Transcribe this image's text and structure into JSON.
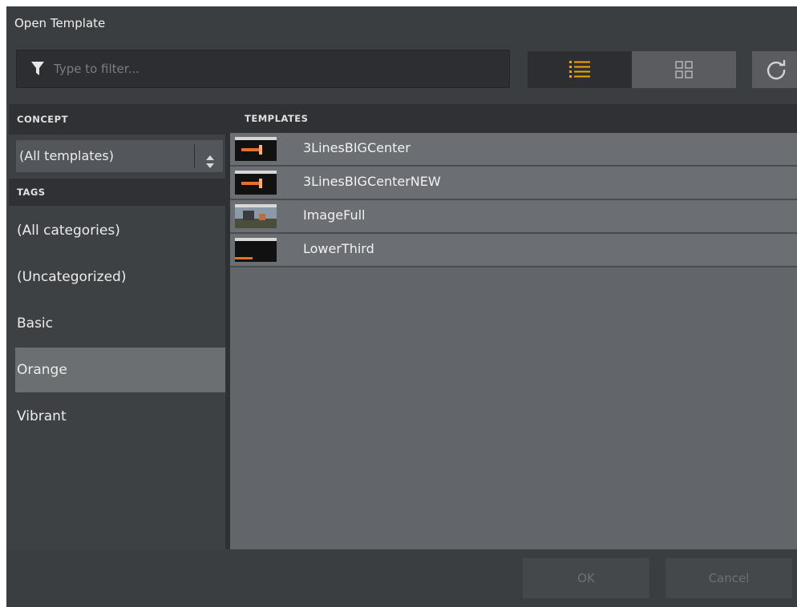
{
  "dialog": {
    "title": "Open Template"
  },
  "toolbar": {
    "filter_placeholder": "Type to filter...",
    "filter_value": "",
    "filter_icon": "filter-icon",
    "list_view_icon": "list-view-icon",
    "grid_view_icon": "grid-view-icon",
    "refresh_icon": "refresh-icon",
    "active_view": "list"
  },
  "concept": {
    "header": "CONCEPT",
    "selected": "(All templates)"
  },
  "tags": {
    "header": "TAGS",
    "items": [
      {
        "label": "(All categories)",
        "selected": false
      },
      {
        "label": "(Uncategorized)",
        "selected": false
      },
      {
        "label": "Basic",
        "selected": false
      },
      {
        "label": "Orange",
        "selected": true
      },
      {
        "label": "Vibrant",
        "selected": false
      }
    ]
  },
  "templates": {
    "header": "TEMPLATES",
    "items": [
      {
        "name": "3LinesBIGCenter",
        "thumb": "orange-bar"
      },
      {
        "name": "3LinesBIGCenterNEW",
        "thumb": "orange-bar"
      },
      {
        "name": "ImageFull",
        "thumb": "image"
      },
      {
        "name": "LowerThird",
        "thumb": "lower-third"
      }
    ]
  },
  "footer": {
    "ok_label": "OK",
    "cancel_label": "Cancel"
  },
  "colors": {
    "accent": "#f0a500",
    "background": "#3e4144",
    "list_background": "#62656a",
    "selected_tag": "#6c6f72"
  }
}
